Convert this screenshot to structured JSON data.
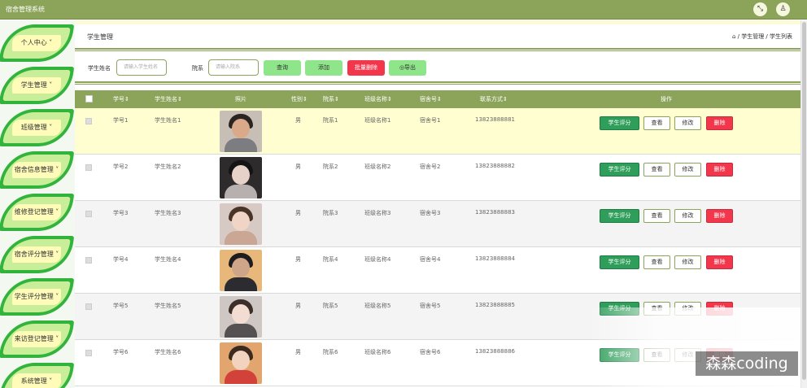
{
  "app": {
    "title": "宿舍管理系统",
    "icons": [
      "fullscreen-icon",
      "user-icon"
    ],
    "fullscreen_glyph": "⤡",
    "user_glyph": "♙"
  },
  "sidebar": {
    "items": [
      {
        "label": "个人中心 ˅"
      },
      {
        "label": "学生管理 ˅"
      },
      {
        "label": "班级管理 ˅"
      },
      {
        "label": "宿舍信息管理 ˅"
      },
      {
        "label": "维修登记管理 ˅"
      },
      {
        "label": "宿舍评分管理 ˅"
      },
      {
        "label": "学生评分管理 ˅"
      },
      {
        "label": "来访登记管理 ˅"
      },
      {
        "label": "系统管理 ˅"
      }
    ]
  },
  "page": {
    "title": "学生管理",
    "breadcrumb": "⌂ / 学生管理 / 学生列表"
  },
  "search": {
    "name_label": "学生姓名",
    "name_placeholder": "请输入学生姓名",
    "dept_label": "院系",
    "dept_placeholder": "请输入院系",
    "query_label": "查询",
    "add_label": "添加",
    "batch_delete_label": "批量删除",
    "export_label": "◎导出"
  },
  "table": {
    "headers": [
      "学号⇕",
      "学生姓名⇕",
      "照片",
      "性别⇕",
      "院系⇕",
      "班级名称⇕",
      "宿舍号⇕",
      "联系方式⇕",
      "操作"
    ],
    "action_labels": {
      "score": "学生评分",
      "view": "查看",
      "edit": "修改",
      "delete": "删除"
    },
    "rows": [
      {
        "id": "学号1",
        "name": "学生姓名1",
        "gender": "男",
        "dept": "院系1",
        "class": "班级名称1",
        "dorm": "宿舍号1",
        "phone": "13823888881",
        "photo": {
          "bg": "#c7bfb5",
          "hair": "#2a2522",
          "skin": "#d9a98a",
          "body": "#7c7d80"
        }
      },
      {
        "id": "学号2",
        "name": "学生姓名2",
        "gender": "男",
        "dept": "院系2",
        "class": "班级名称2",
        "dorm": "宿舍号2",
        "phone": "13823888882",
        "photo": {
          "bg": "#2d2b2c",
          "hair": "#151314",
          "skin": "#e6d2c8",
          "body": "#b7b0ae"
        }
      },
      {
        "id": "学号3",
        "name": "学生姓名3",
        "gender": "男",
        "dept": "院系3",
        "class": "班级名称3",
        "dorm": "宿舍号3",
        "phone": "13823888883",
        "photo": {
          "bg": "#d7c9c3",
          "hair": "#4a3428",
          "skin": "#f0d5c6",
          "body": "#caa694"
        }
      },
      {
        "id": "学号4",
        "name": "学生姓名4",
        "gender": "男",
        "dept": "院系4",
        "class": "班级名称4",
        "dorm": "宿舍号4",
        "phone": "13823888884",
        "photo": {
          "bg": "#e8b87a",
          "hair": "#1d1d1f",
          "skin": "#cfa58a",
          "body": "#2c2c30"
        }
      },
      {
        "id": "学号5",
        "name": "学生姓名5",
        "gender": "男",
        "dept": "院系5",
        "class": "班级名称5",
        "dorm": "宿舍号5",
        "phone": "13823888885",
        "photo": {
          "bg": "#cfc7c4",
          "hair": "#3b2f2c",
          "skin": "#f3dcd2",
          "body": "#555152"
        }
      },
      {
        "id": "学号6",
        "name": "学生姓名6",
        "gender": "男",
        "dept": "院系6",
        "class": "班级名称6",
        "dorm": "宿舍号6",
        "phone": "13823888886",
        "photo": {
          "bg": "#e2a56d",
          "hair": "#3a2a20",
          "skin": "#f2d3bf",
          "body": "#d2423a"
        }
      }
    ]
  },
  "watermark": "森森coding",
  "colors": {
    "topbar": "#8ca35a",
    "accent_green": "#8fe68a",
    "danger": "#f2374d",
    "score_button": "#2f9e5a",
    "highlight_row": "#fffed0",
    "alt_row": "#f4f4f4"
  }
}
